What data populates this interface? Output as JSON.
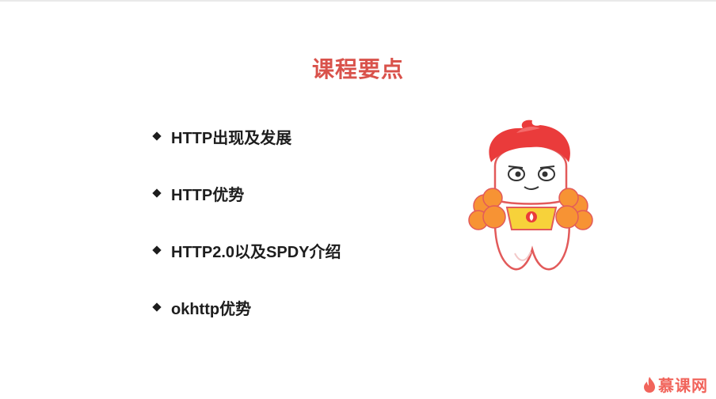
{
  "slide": {
    "title": "课程要点",
    "bullets": [
      "HTTP出现及发展",
      "HTTP优势",
      "HTTP2.0以及SPDY介绍",
      "okhttp优势"
    ]
  },
  "logo": {
    "text": "慕课网",
    "icon": "flame-icon"
  },
  "colors": {
    "title": "#d9524b",
    "text": "#1d1d1d",
    "brand": "#f0544a",
    "mascot_hair": "#ea3b3b",
    "mascot_pompom": "#f79334"
  }
}
